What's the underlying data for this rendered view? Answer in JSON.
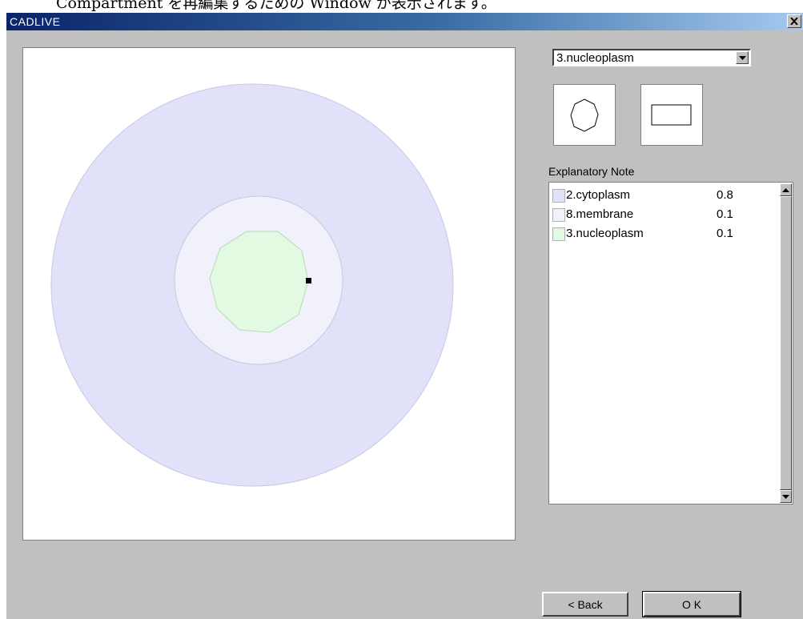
{
  "caption": {
    "text": "Compartment を再編集するための Window が表示されます。"
  },
  "window": {
    "title": "CADLIVE"
  },
  "compartment_select": {
    "selected": "3.nucleoplasm"
  },
  "shape_buttons": [
    {
      "icon": "circle-shape-icon"
    },
    {
      "icon": "rectangle-shape-icon"
    }
  ],
  "explanatory_note": {
    "label": "Explanatory Note",
    "items": [
      {
        "name": "2.cytoplasm",
        "value": "0.8",
        "color": "#e1e1f9"
      },
      {
        "name": "8.membrane",
        "value": "0.1",
        "color": "#f1f1fb"
      },
      {
        "name": "3.nucleoplasm",
        "value": "0.1",
        "color": "#e1fae1"
      }
    ]
  },
  "buttons": {
    "back": "< Back",
    "ok": "O K"
  },
  "colors": {
    "cytoplasm": "#e1e1f9",
    "membrane": "#f1f1fb",
    "nucleoplasm": "#e1fae1",
    "titlebar_start": "#0a246a"
  }
}
